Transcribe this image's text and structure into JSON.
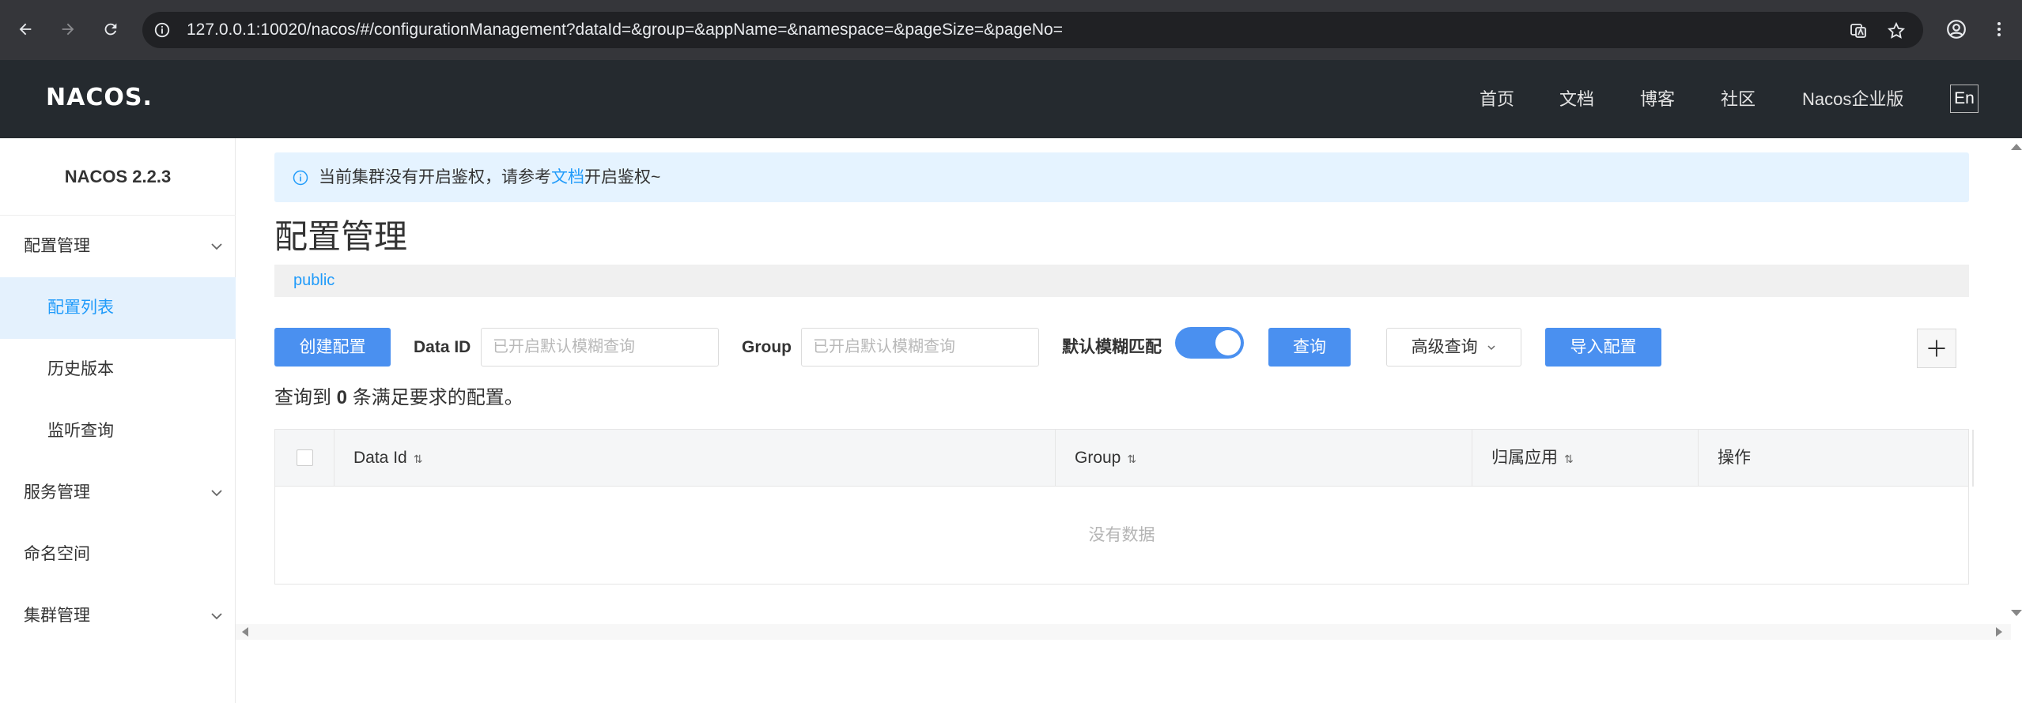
{
  "browser": {
    "url": "127.0.0.1:10020/nacos/#/configurationManagement?dataId=&group=&appName=&namespace=&pageSize=&pageNo="
  },
  "header": {
    "logo": "NACOS.",
    "nav": [
      "首页",
      "文档",
      "博客",
      "社区",
      "Nacos企业版"
    ],
    "lang": "En"
  },
  "sidebar": {
    "title": "NACOS 2.2.3",
    "items": [
      {
        "label": "配置管理"
      },
      {
        "label": "配置列表"
      },
      {
        "label": "历史版本"
      },
      {
        "label": "监听查询"
      },
      {
        "label": "服务管理"
      },
      {
        "label": "命名空间"
      },
      {
        "label": "集群管理"
      }
    ]
  },
  "notice": {
    "before": "当前集群没有开启鉴权，请参考",
    "link": "文档",
    "after": "开启鉴权~"
  },
  "page": {
    "title": "配置管理",
    "namespace": "public"
  },
  "toolbar": {
    "create_label": "创建配置",
    "dataid_label": "Data ID",
    "dataid_placeholder": "已开启默认模糊查询",
    "group_label": "Group",
    "group_placeholder": "已开启默认模糊查询",
    "fuzzy_label": "默认模糊匹配",
    "fuzzy_on": true,
    "query_label": "查询",
    "advanced_label": "高级查询",
    "import_label": "导入配置",
    "add_icon": "plus-icon"
  },
  "summary": {
    "prefix": "查询到",
    "count": "0",
    "suffix": "条满足要求的配置。"
  },
  "table": {
    "columns": [
      "Data Id",
      "Group",
      "归属应用",
      "操作"
    ],
    "empty_text": "没有数据"
  },
  "colors": {
    "primary": "#4a90f0",
    "header_bg": "#252a2f",
    "link": "#209bfa"
  }
}
